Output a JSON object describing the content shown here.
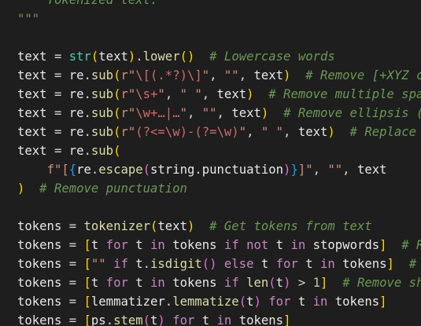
{
  "editor": {
    "background": "#1e1e1e",
    "language": "python",
    "token_colors": {
      "plain": "#d4d4d4",
      "builtin": "#4ec9b0",
      "function": "#dcdcaa",
      "string": "#ce9178",
      "comment": "#6a9955",
      "keyword": "#c586c0",
      "number": "#b5cea8",
      "bracket_level_1": "#ffd700",
      "bracket_level_2": "#da70d6",
      "bracket_level_3": "#179fff"
    },
    "lines": [
      [
        {
          "t": "    Tokenized text.",
          "k": "comment"
        }
      ],
      [
        {
          "t": "\"\"\"",
          "k": "comment"
        }
      ],
      [],
      [
        {
          "t": "text",
          "k": "var"
        },
        {
          "t": " = ",
          "k": "op"
        },
        {
          "t": "str",
          "k": "builtin"
        },
        {
          "t": "(",
          "k": "p1"
        },
        {
          "t": "text",
          "k": "var"
        },
        {
          "t": ")",
          "k": "p1"
        },
        {
          "t": ".",
          "k": "op"
        },
        {
          "t": "lower",
          "k": "func"
        },
        {
          "t": "()",
          "k": "p1"
        },
        {
          "t": "  ",
          "k": "plain"
        },
        {
          "t": "# Lowercase words",
          "k": "comment"
        }
      ],
      [
        {
          "t": "text",
          "k": "var"
        },
        {
          "t": " = ",
          "k": "op"
        },
        {
          "t": "re",
          "k": "var"
        },
        {
          "t": ".",
          "k": "op"
        },
        {
          "t": "sub",
          "k": "func"
        },
        {
          "t": "(",
          "k": "p1"
        },
        {
          "t": "r\"",
          "k": "string"
        },
        {
          "t": "\\[(.*?)\\]",
          "k": "regex"
        },
        {
          "t": "\"",
          "k": "string"
        },
        {
          "t": ", ",
          "k": "op"
        },
        {
          "t": "\"\"",
          "k": "string"
        },
        {
          "t": ", ",
          "k": "op"
        },
        {
          "t": "text",
          "k": "var"
        },
        {
          "t": ")",
          "k": "p1"
        },
        {
          "t": "  ",
          "k": "plain"
        },
        {
          "t": "# Remove [+XYZ chars] in content",
          "k": "comment"
        }
      ],
      [
        {
          "t": "text",
          "k": "var"
        },
        {
          "t": " = ",
          "k": "op"
        },
        {
          "t": "re",
          "k": "var"
        },
        {
          "t": ".",
          "k": "op"
        },
        {
          "t": "sub",
          "k": "func"
        },
        {
          "t": "(",
          "k": "p1"
        },
        {
          "t": "r\"",
          "k": "string"
        },
        {
          "t": "\\s+",
          "k": "regex"
        },
        {
          "t": "\"",
          "k": "string"
        },
        {
          "t": ", ",
          "k": "op"
        },
        {
          "t": "\" \"",
          "k": "string"
        },
        {
          "t": ", ",
          "k": "op"
        },
        {
          "t": "text",
          "k": "var"
        },
        {
          "t": ")",
          "k": "p1"
        },
        {
          "t": "  ",
          "k": "plain"
        },
        {
          "t": "# Remove multiple spaces in content",
          "k": "comment"
        }
      ],
      [
        {
          "t": "text",
          "k": "var"
        },
        {
          "t": " = ",
          "k": "op"
        },
        {
          "t": "re",
          "k": "var"
        },
        {
          "t": ".",
          "k": "op"
        },
        {
          "t": "sub",
          "k": "func"
        },
        {
          "t": "(",
          "k": "p1"
        },
        {
          "t": "r\"",
          "k": "string"
        },
        {
          "t": "\\w+…|…",
          "k": "regex"
        },
        {
          "t": "\"",
          "k": "string"
        },
        {
          "t": ", ",
          "k": "op"
        },
        {
          "t": "\"\"",
          "k": "string"
        },
        {
          "t": ", ",
          "k": "op"
        },
        {
          "t": "text",
          "k": "var"
        },
        {
          "t": ")",
          "k": "p1"
        },
        {
          "t": "  ",
          "k": "plain"
        },
        {
          "t": "# Remove ellipsis (and last word)",
          "k": "comment"
        }
      ],
      [
        {
          "t": "text",
          "k": "var"
        },
        {
          "t": " = ",
          "k": "op"
        },
        {
          "t": "re",
          "k": "var"
        },
        {
          "t": ".",
          "k": "op"
        },
        {
          "t": "sub",
          "k": "func"
        },
        {
          "t": "(",
          "k": "p1"
        },
        {
          "t": "r\"",
          "k": "string"
        },
        {
          "t": "(?<=\\w)-(?=\\w)",
          "k": "regex"
        },
        {
          "t": "\"",
          "k": "string"
        },
        {
          "t": ", ",
          "k": "op"
        },
        {
          "t": "\" \"",
          "k": "string"
        },
        {
          "t": ", ",
          "k": "op"
        },
        {
          "t": "text",
          "k": "var"
        },
        {
          "t": ")",
          "k": "p1"
        },
        {
          "t": "  ",
          "k": "plain"
        },
        {
          "t": "# Replace dash between words",
          "k": "comment"
        }
      ],
      [
        {
          "t": "text",
          "k": "var"
        },
        {
          "t": " = ",
          "k": "op"
        },
        {
          "t": "re",
          "k": "var"
        },
        {
          "t": ".",
          "k": "op"
        },
        {
          "t": "sub",
          "k": "func"
        },
        {
          "t": "(",
          "k": "p1"
        }
      ],
      [
        {
          "t": "    ",
          "k": "plain"
        },
        {
          "t": "f\"",
          "k": "string"
        },
        {
          "t": "[",
          "k": "string"
        },
        {
          "t": "{",
          "k": "p3"
        },
        {
          "t": "re",
          "k": "var"
        },
        {
          "t": ".",
          "k": "op"
        },
        {
          "t": "escape",
          "k": "func"
        },
        {
          "t": "(",
          "k": "p2"
        },
        {
          "t": "string",
          "k": "var"
        },
        {
          "t": ".",
          "k": "op"
        },
        {
          "t": "punctuation",
          "k": "var"
        },
        {
          "t": ")",
          "k": "p2"
        },
        {
          "t": "}",
          "k": "p3"
        },
        {
          "t": "]\"",
          "k": "string"
        },
        {
          "t": ", ",
          "k": "op"
        },
        {
          "t": "\"\"",
          "k": "string"
        },
        {
          "t": ", ",
          "k": "op"
        },
        {
          "t": "text",
          "k": "var"
        }
      ],
      [
        {
          "t": ")",
          "k": "p1"
        },
        {
          "t": "  ",
          "k": "plain"
        },
        {
          "t": "# Remove punctuation",
          "k": "comment"
        }
      ],
      [],
      [
        {
          "t": "tokens",
          "k": "var"
        },
        {
          "t": " = ",
          "k": "op"
        },
        {
          "t": "tokenizer",
          "k": "func"
        },
        {
          "t": "(",
          "k": "p1"
        },
        {
          "t": "text",
          "k": "var"
        },
        {
          "t": ")",
          "k": "p1"
        },
        {
          "t": "  ",
          "k": "plain"
        },
        {
          "t": "# Get tokens from text",
          "k": "comment"
        }
      ],
      [
        {
          "t": "tokens",
          "k": "var"
        },
        {
          "t": " = ",
          "k": "op"
        },
        {
          "t": "[",
          "k": "p1"
        },
        {
          "t": "t",
          "k": "var"
        },
        {
          "t": " for ",
          "k": "keyword"
        },
        {
          "t": "t",
          "k": "var"
        },
        {
          "t": " in ",
          "k": "keyword"
        },
        {
          "t": "tokens",
          "k": "var"
        },
        {
          "t": " if ",
          "k": "keyword"
        },
        {
          "t": "not",
          "k": "keyword"
        },
        {
          "t": " t",
          "k": "var"
        },
        {
          "t": " in ",
          "k": "keyword"
        },
        {
          "t": "stopwords",
          "k": "var"
        },
        {
          "t": "]",
          "k": "p1"
        },
        {
          "t": "  ",
          "k": "plain"
        },
        {
          "t": "# Remove stopwords",
          "k": "comment"
        }
      ],
      [
        {
          "t": "tokens",
          "k": "var"
        },
        {
          "t": " = ",
          "k": "op"
        },
        {
          "t": "[",
          "k": "p1"
        },
        {
          "t": "\"\"",
          "k": "string"
        },
        {
          "t": " if ",
          "k": "keyword"
        },
        {
          "t": "t",
          "k": "var"
        },
        {
          "t": ".",
          "k": "op"
        },
        {
          "t": "isdigit",
          "k": "func"
        },
        {
          "t": "()",
          "k": "p2"
        },
        {
          "t": " else ",
          "k": "keyword"
        },
        {
          "t": "t",
          "k": "var"
        },
        {
          "t": " for ",
          "k": "keyword"
        },
        {
          "t": "t",
          "k": "var"
        },
        {
          "t": " in ",
          "k": "keyword"
        },
        {
          "t": "tokens",
          "k": "var"
        },
        {
          "t": "]",
          "k": "p1"
        },
        {
          "t": "  ",
          "k": "plain"
        },
        {
          "t": "# Remove digits",
          "k": "comment"
        }
      ],
      [
        {
          "t": "tokens",
          "k": "var"
        },
        {
          "t": " = ",
          "k": "op"
        },
        {
          "t": "[",
          "k": "p1"
        },
        {
          "t": "t",
          "k": "var"
        },
        {
          "t": " for ",
          "k": "keyword"
        },
        {
          "t": "t",
          "k": "var"
        },
        {
          "t": " in ",
          "k": "keyword"
        },
        {
          "t": "tokens",
          "k": "var"
        },
        {
          "t": " if ",
          "k": "keyword"
        },
        {
          "t": "len",
          "k": "func"
        },
        {
          "t": "(",
          "k": "p2"
        },
        {
          "t": "t",
          "k": "var"
        },
        {
          "t": ")",
          "k": "p2"
        },
        {
          "t": " > ",
          "k": "op"
        },
        {
          "t": "1",
          "k": "number"
        },
        {
          "t": "]",
          "k": "p1"
        },
        {
          "t": "  ",
          "k": "plain"
        },
        {
          "t": "# Remove short tokens",
          "k": "comment"
        }
      ],
      [
        {
          "t": "tokens",
          "k": "var"
        },
        {
          "t": " = ",
          "k": "op"
        },
        {
          "t": "[",
          "k": "p1"
        },
        {
          "t": "lemmatizer",
          "k": "var"
        },
        {
          "t": ".",
          "k": "op"
        },
        {
          "t": "lemmatize",
          "k": "func"
        },
        {
          "t": "(",
          "k": "p2"
        },
        {
          "t": "t",
          "k": "var"
        },
        {
          "t": ")",
          "k": "p2"
        },
        {
          "t": " for ",
          "k": "keyword"
        },
        {
          "t": "t",
          "k": "var"
        },
        {
          "t": " in ",
          "k": "keyword"
        },
        {
          "t": "tokens",
          "k": "var"
        },
        {
          "t": "]",
          "k": "p1"
        }
      ],
      [
        {
          "t": "tokens",
          "k": "var"
        },
        {
          "t": " = ",
          "k": "op"
        },
        {
          "t": "[",
          "k": "p1"
        },
        {
          "t": "ps",
          "k": "var"
        },
        {
          "t": ".",
          "k": "op"
        },
        {
          "t": "stem",
          "k": "func"
        },
        {
          "t": "(",
          "k": "p2"
        },
        {
          "t": "t",
          "k": "var"
        },
        {
          "t": ")",
          "k": "p2"
        },
        {
          "t": " for ",
          "k": "keyword"
        },
        {
          "t": "t",
          "k": "var"
        },
        {
          "t": " in ",
          "k": "keyword"
        },
        {
          "t": "tokens",
          "k": "var"
        },
        {
          "t": "]",
          "k": "p1"
        }
      ]
    ]
  }
}
